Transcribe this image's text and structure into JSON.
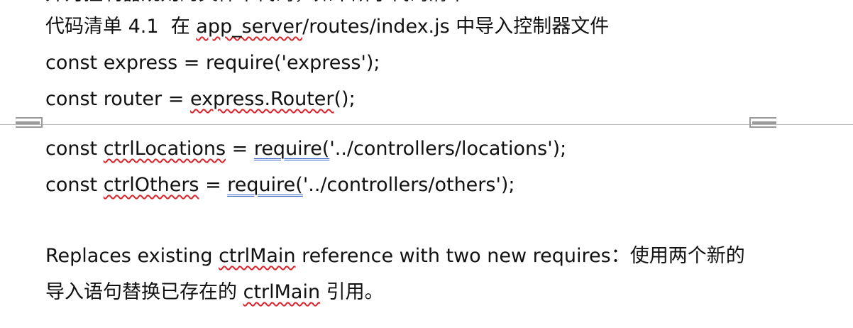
{
  "document": {
    "top_cut_text": "外为控制器规则的文件中代码，如下所示代码清单",
    "caption": {
      "label": "代码清单 4.1",
      "text_before_path": "在 ",
      "path": "app_server",
      "path_rest": "/routes/index.js",
      "text_after_path": " 中导入控制器文件"
    },
    "code_lines": {
      "line1": "const express = require('express');",
      "line2_prefix": "const router = ",
      "line2_squiggle": "express.Router",
      "line2_suffix": "();",
      "line3_prefix": "const ",
      "line3_squiggle": "ctrlLocations",
      "line3_mid": " = ",
      "line3_double": "require(",
      "line3_suffix": "'../controllers/locations');",
      "line4_prefix": "const ",
      "line4_squiggle": "ctrlOthers",
      "line4_mid": " = ",
      "line4_double": "require(",
      "line4_suffix": "'../controllers/others');"
    },
    "paragraph": {
      "p1_prefix": "Replaces existing ",
      "p1_squiggle": "ctrlMain",
      "p1_suffix": " reference with two new requires：使用两个新的",
      "p2_prefix": "导入语句替换已存在的 ",
      "p2_squiggle": "ctrlMain",
      "p2_suffix": " 引用。"
    }
  }
}
